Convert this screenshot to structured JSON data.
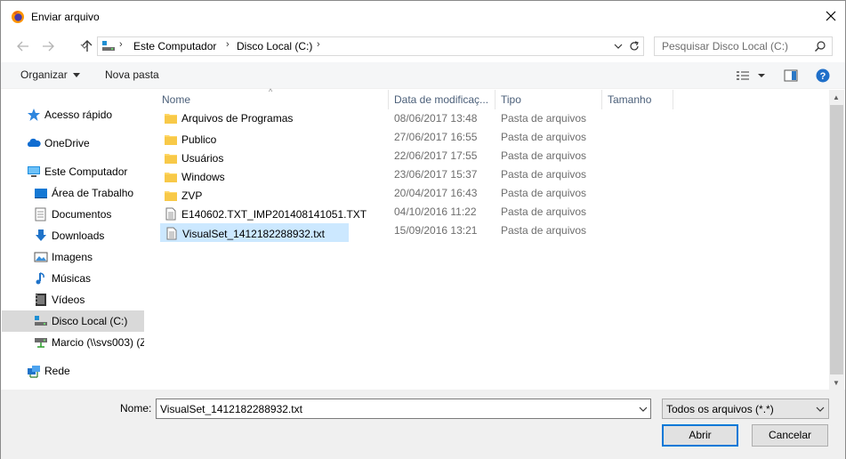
{
  "window": {
    "title": "Enviar arquivo"
  },
  "address": {
    "crumbs": [
      "Este Computador",
      "Disco Local (C:)"
    ],
    "search_placeholder": "Pesquisar Disco Local (C:)"
  },
  "toolbar": {
    "organize_label": "Organizar",
    "new_folder_label": "Nova pasta"
  },
  "sidebar": {
    "items": [
      {
        "label": "Acesso rápido",
        "icon": "star-icon"
      },
      {
        "label": "OneDrive",
        "icon": "cloud-icon"
      },
      {
        "label": "Este Computador",
        "icon": "computer-icon"
      },
      {
        "label": "Área de Trabalho",
        "icon": "desktop-icon"
      },
      {
        "label": "Documentos",
        "icon": "documents-icon"
      },
      {
        "label": "Downloads",
        "icon": "download-icon"
      },
      {
        "label": "Imagens",
        "icon": "pictures-icon"
      },
      {
        "label": "Músicas",
        "icon": "music-icon"
      },
      {
        "label": "Vídeos",
        "icon": "videos-icon"
      },
      {
        "label": "Disco Local (C:)",
        "icon": "drive-icon",
        "selected": true
      },
      {
        "label": "Marcio (\\\\svs003) (Z",
        "icon": "network-drive-icon"
      },
      {
        "label": "Rede",
        "icon": "network-icon"
      }
    ]
  },
  "columns": [
    "Nome",
    "Data de modificaç...",
    "Tipo",
    "Tamanho"
  ],
  "files": [
    {
      "name": "Arquivos de Programas",
      "date": "08/06/2017 13:48",
      "type": "Pasta de arquivos",
      "kind": "folder"
    },
    {
      "name": "Publico",
      "date": "27/06/2017 16:55",
      "type": "Pasta de arquivos",
      "kind": "folder"
    },
    {
      "name": "Usuários",
      "date": "22/06/2017 17:55",
      "type": "Pasta de arquivos",
      "kind": "folder"
    },
    {
      "name": "Windows",
      "date": "23/06/2017 15:37",
      "type": "Pasta de arquivos",
      "kind": "folder"
    },
    {
      "name": "ZVP",
      "date": "20/04/2017 16:43",
      "type": "Pasta de arquivos",
      "kind": "folder"
    },
    {
      "name": "E140602.TXT_IMP201408141051.TXT",
      "date": "04/10/2016 11:22",
      "type": "Pasta de arquivos",
      "kind": "file"
    },
    {
      "name": "VisualSet_1412182288932.txt",
      "date": "15/09/2016 13:21",
      "type": "Pasta de arquivos",
      "kind": "file",
      "selected": true
    }
  ],
  "bottom": {
    "name_label": "Nome:",
    "name_value": "VisualSet_1412182288932.txt",
    "filter_value": "Todos os arquivos (*.*)",
    "open_label": "Abrir",
    "cancel_label": "Cancelar"
  },
  "colors": {
    "selection": "#cce8ff",
    "nav_selected": "#d9d9d9",
    "accent": "#0078d7"
  }
}
